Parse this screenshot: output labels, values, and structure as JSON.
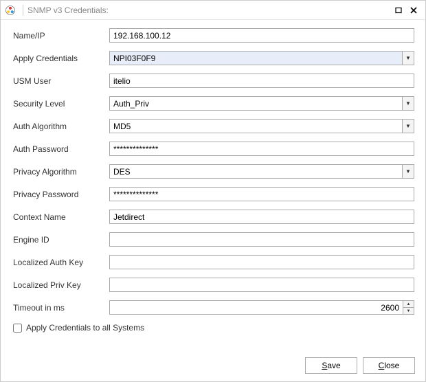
{
  "window": {
    "title": "SNMP v3 Credentials:"
  },
  "fields": {
    "name_ip": {
      "label": "Name/IP",
      "value": "192.168.100.12"
    },
    "apply_credentials": {
      "label": "Apply Credentials",
      "value": "NPI03F0F9"
    },
    "usm_user": {
      "label": "USM User",
      "value": "itelio"
    },
    "security_level": {
      "label": "Security Level",
      "value": "Auth_Priv"
    },
    "auth_algorithm": {
      "label": "Auth Algorithm",
      "value": "MD5"
    },
    "auth_password": {
      "label": "Auth Password",
      "value": "**************"
    },
    "privacy_algorithm": {
      "label": "Privacy Algorithm",
      "value": "DES"
    },
    "privacy_password": {
      "label": "Privacy Password",
      "value": "**************"
    },
    "context_name": {
      "label": "Context Name",
      "value": "Jetdirect"
    },
    "engine_id": {
      "label": "Engine ID",
      "value": ""
    },
    "localized_auth_key": {
      "label": "Localized Auth Key",
      "value": ""
    },
    "localized_priv_key": {
      "label": "Localized Priv Key",
      "value": ""
    },
    "timeout_ms": {
      "label": "Timeout in ms",
      "value": "2600"
    }
  },
  "checkbox": {
    "apply_all": {
      "label": "Apply Credentials to all Systems",
      "checked": false
    }
  },
  "buttons": {
    "save": "Save",
    "close": "Close"
  }
}
